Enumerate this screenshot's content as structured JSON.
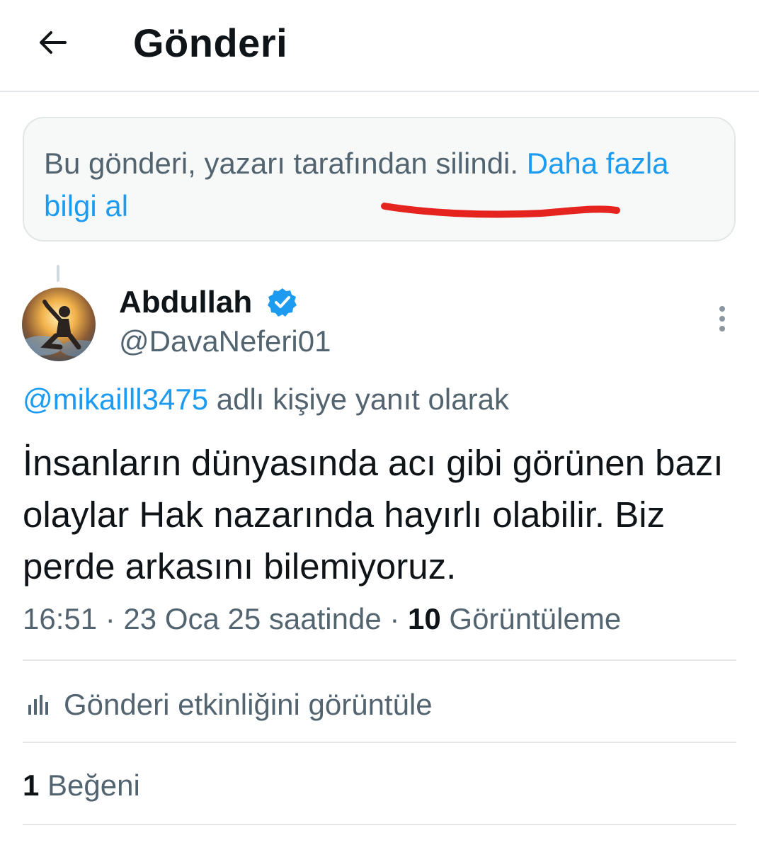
{
  "header": {
    "title": "Gönderi"
  },
  "deleted_notice": {
    "text": "Bu gönderi, yazarı tarafından silindi. ",
    "link": "Daha fazla bilgi al"
  },
  "post": {
    "display_name": "Abdullah",
    "handle": "@DavaNeferi01",
    "reply_to": "@mikailll3475",
    "reply_suffix": " adlı kişiye yanıt olarak",
    "text": "İnsanların dünyasında acı gibi görünen bazı olaylar Hak nazarında hayırlı olabilir. Biz perde arkasını bilemiyoruz.",
    "timestamp": "16:51 · 23 Oca 25 saatinde · ",
    "views_count": "10",
    "views_label": " Görüntüleme",
    "activity_label": "Gönderi etkinliğini görüntüle",
    "likes_count": "1",
    "likes_label": " Beğeni"
  },
  "icons": {
    "back": "back-arrow-icon",
    "verified": "verified-badge-icon",
    "more": "more-vertical-icon",
    "activity": "bar-chart-icon"
  },
  "colors": {
    "link": "#1d9bf0",
    "secondary_text": "#536471",
    "primary_text": "#0f1419",
    "annotation_red": "#e52420"
  }
}
